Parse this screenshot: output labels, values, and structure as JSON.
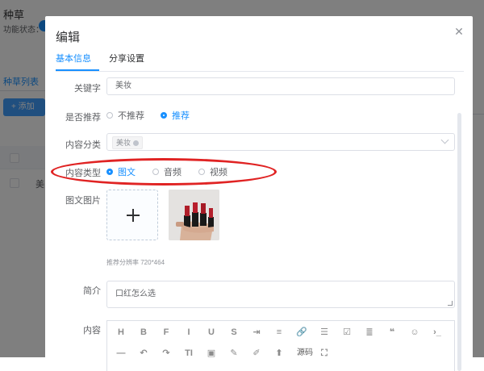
{
  "background": {
    "title": "种草",
    "status_label": "功能状态：",
    "tab_label": "种草列表",
    "add_button": "+ 添加",
    "row_text": "美"
  },
  "dialog": {
    "title": "编辑",
    "tabs": [
      {
        "label": "基本信息",
        "active": true
      },
      {
        "label": "分享设置",
        "active": false
      }
    ],
    "fields": {
      "keyword": {
        "label": "关键字",
        "value": "美妆"
      },
      "recommend": {
        "label": "是否推荐",
        "options": [
          {
            "label": "不推荐",
            "checked": false
          },
          {
            "label": "推荐",
            "checked": true
          }
        ]
      },
      "category": {
        "label": "内容分类",
        "tags": [
          "美妆"
        ]
      },
      "content_type": {
        "label": "内容类型",
        "options": [
          {
            "label": "图文",
            "checked": true
          },
          {
            "label": "音频",
            "checked": false
          },
          {
            "label": "视频",
            "checked": false
          }
        ]
      },
      "images": {
        "label": "图文图片",
        "hint": "推荐分辨率 720*464"
      },
      "intro": {
        "label": "简介",
        "value": "口红怎么选"
      },
      "content": {
        "label": "内容"
      }
    },
    "toolbar_row1": [
      "H",
      "B",
      "F",
      "I",
      "U",
      "S",
      "⇥",
      "≡",
      "🔗",
      "☰",
      "☑",
      "≣",
      "❝",
      "☺",
      "›_"
    ],
    "toolbar_row2": [
      "—",
      "↶",
      "↷",
      "TI",
      "▣",
      "✎",
      "✐",
      "⬆",
      "源码",
      "⛶"
    ],
    "toolbar_row1_icons": [
      "heading-icon",
      "bold-icon",
      "font-icon",
      "italic-icon",
      "underline-icon",
      "strikethrough-icon",
      "indent-icon",
      "align-icon",
      "link-icon",
      "list-icon",
      "checkbox-icon",
      "paragraph-icon",
      "quote-icon",
      "emoji-icon",
      "code-icon"
    ],
    "toolbar_row2_icons": [
      "hr-icon",
      "undo-icon",
      "redo-icon",
      "clear-format-icon",
      "image-icon",
      "pen-icon",
      "brush-icon",
      "upload-icon",
      "source-code-button",
      "fullscreen-icon"
    ]
  },
  "colors": {
    "accent": "#1890ff",
    "annotation": "#e02323"
  }
}
